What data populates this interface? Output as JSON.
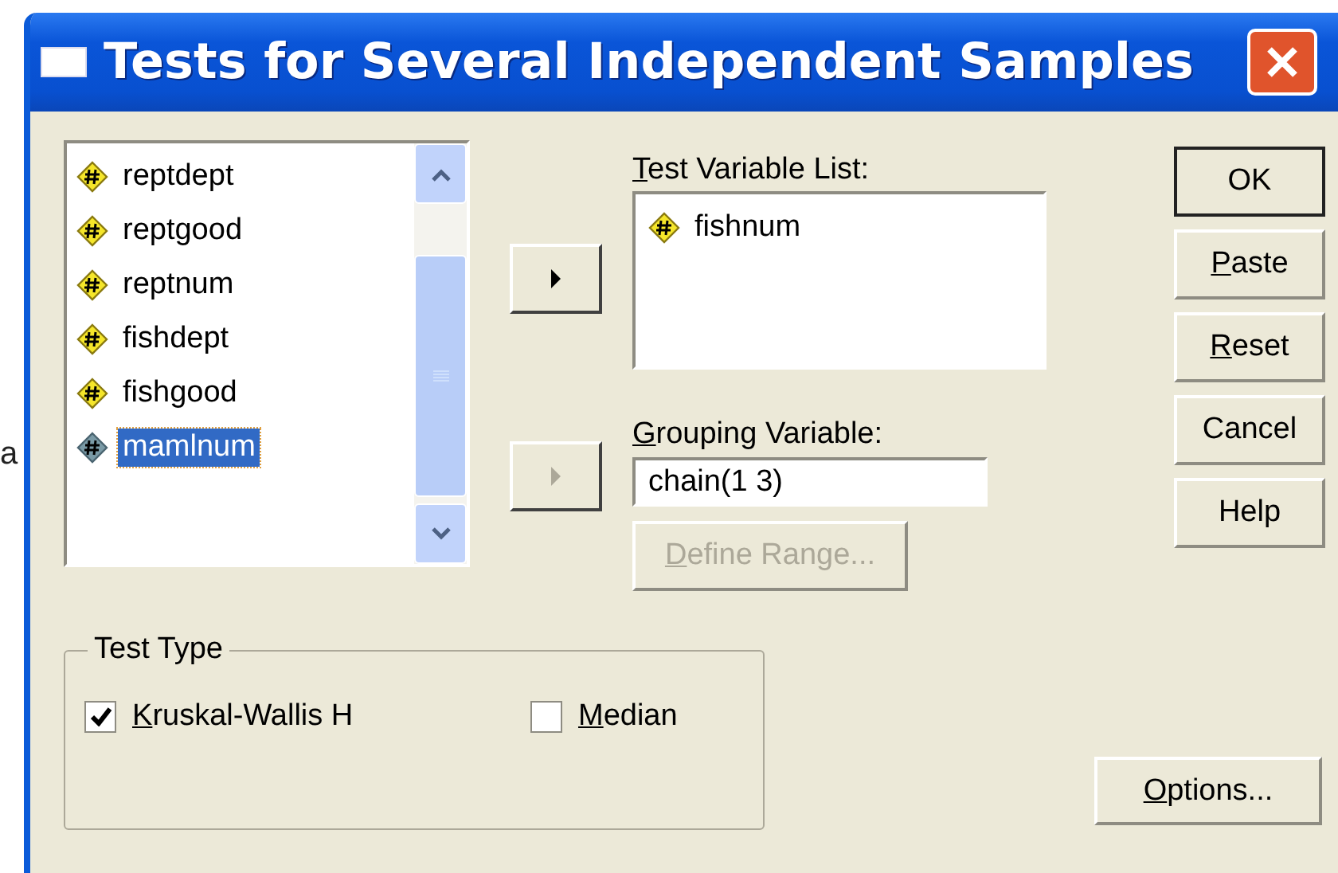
{
  "outside_text": "a",
  "window": {
    "title": "Tests for Several Independent Samples"
  },
  "variables": [
    {
      "name": "reptdept",
      "selected": false
    },
    {
      "name": "reptgood",
      "selected": false
    },
    {
      "name": "reptnum",
      "selected": false
    },
    {
      "name": "fishdept",
      "selected": false
    },
    {
      "name": "fishgood",
      "selected": false
    },
    {
      "name": "mamlnum",
      "selected": true
    }
  ],
  "move_buttons": [
    {
      "disabled": false
    },
    {
      "disabled": true
    }
  ],
  "test_variable_list": {
    "label": "Test Variable List:",
    "underline_first": true,
    "items": [
      {
        "name": "fishnum"
      }
    ]
  },
  "grouping_variable": {
    "label": "Grouping Variable:",
    "underline_first": true,
    "value": "chain(1 3)"
  },
  "define_range": {
    "label": "Define Range...",
    "underline_first": true,
    "disabled": true
  },
  "buttons": [
    {
      "label": "OK",
      "underline_first": false,
      "default": true
    },
    {
      "label": "Paste",
      "underline_first": true,
      "default": false
    },
    {
      "label": "Reset",
      "underline_first": true,
      "default": false
    },
    {
      "label": "Cancel",
      "underline_first": false,
      "default": false
    },
    {
      "label": "Help",
      "underline_first": false,
      "default": false
    }
  ],
  "test_type": {
    "title": "Test Type",
    "options": [
      {
        "label": "Kruskal-Wallis H",
        "underline_first": true,
        "checked": true
      },
      {
        "label": "Median",
        "underline_first": true,
        "checked": false
      }
    ]
  },
  "options_button": {
    "label": "Options...",
    "underline_first": true
  }
}
